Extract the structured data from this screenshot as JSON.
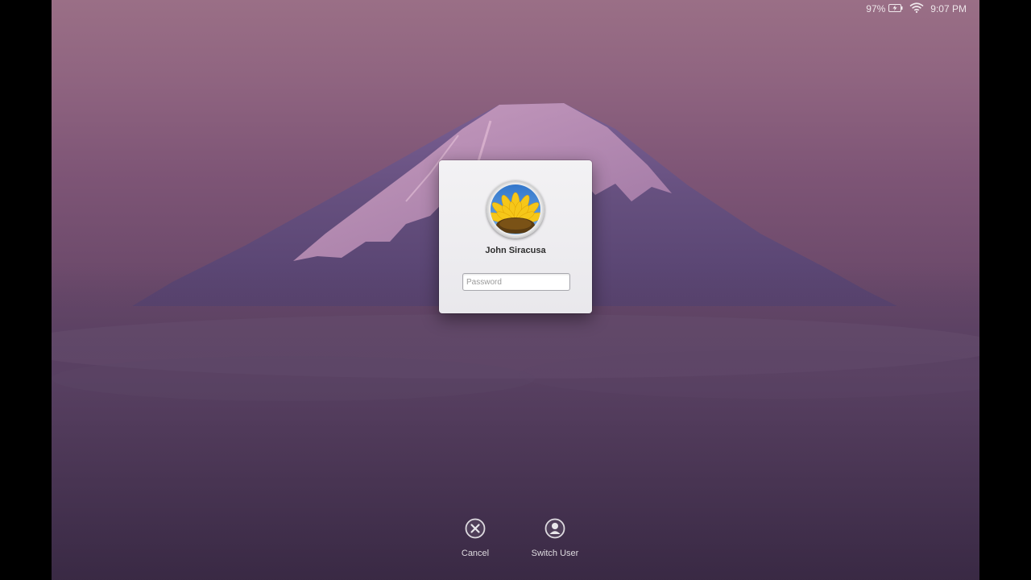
{
  "status_bar": {
    "battery_percent": "97%",
    "time": "9:07 PM",
    "battery_icon": "battery-charging-icon",
    "wifi_icon": "wifi-icon"
  },
  "login": {
    "user_name": "John Siracusa",
    "password_placeholder": "Password",
    "password_value": "",
    "avatar_icon": "sunflower-avatar"
  },
  "actions": {
    "cancel_label": "Cancel",
    "switch_user_label": "Switch User",
    "cancel_icon": "cancel-icon",
    "switch_user_icon": "user-icon"
  },
  "colors": {
    "accent_text": "#ffffff",
    "window_background": "#efeef1"
  }
}
